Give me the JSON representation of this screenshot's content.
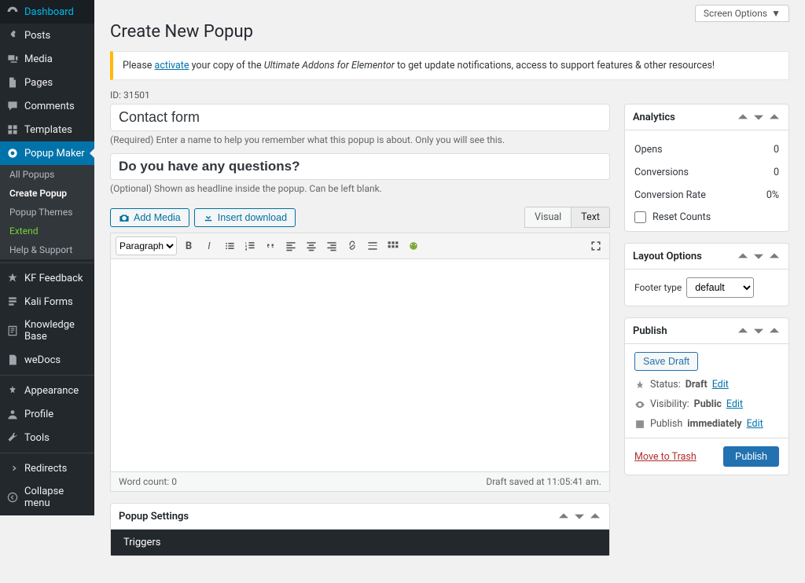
{
  "screen_options": "Screen Options",
  "page_title": "Create New Popup",
  "notice": {
    "prefix": "Please ",
    "activate_link": "activate",
    "middle": " your copy of the ",
    "product": "Ultimate Addons for Elementor",
    "suffix": " to get update notifications, access to support features & other resources!"
  },
  "post_id_label": "ID:",
  "post_id": "31501",
  "title_value": "Contact form",
  "title_hint": "(Required) Enter a name to help you remember what this popup is about. Only you will see this.",
  "headline_value": "Do you have any questions?",
  "headline_hint": "(Optional) Shown as headline inside the popup. Can be left blank.",
  "media": {
    "add_media": "Add Media",
    "insert_download": "Insert download"
  },
  "editor_tabs": {
    "visual": "Visual",
    "text": "Text"
  },
  "format_select": "Paragraph",
  "wordcount_label": "Word count:",
  "wordcount": "0",
  "draft_saved": "Draft saved at 11:05:41 am.",
  "panels": {
    "analytics": {
      "title": "Analytics",
      "opens_label": "Opens",
      "opens_value": "0",
      "conversions_label": "Conversions",
      "conversions_value": "0",
      "rate_label": "Conversion Rate",
      "rate_value": "0%",
      "reset_label": "Reset Counts"
    },
    "layout": {
      "title": "Layout Options",
      "footer_type_label": "Footer type",
      "footer_type_value": "default"
    },
    "publish": {
      "title": "Publish",
      "save_draft": "Save Draft",
      "status_label": "Status:",
      "status_value": "Draft",
      "visibility_label": "Visibility:",
      "visibility_value": "Public",
      "schedule_label": "Publish",
      "schedule_value": "immediately",
      "edit": "Edit",
      "trash": "Move to Trash",
      "publish_btn": "Publish"
    }
  },
  "popup_settings_title": "Popup Settings",
  "popup_settings_tab": "Triggers",
  "sidebar": {
    "items": [
      {
        "label": "Dashboard",
        "icon": "dashboard"
      },
      {
        "label": "Posts",
        "icon": "pin"
      },
      {
        "label": "Media",
        "icon": "media"
      },
      {
        "label": "Pages",
        "icon": "page"
      },
      {
        "label": "Comments",
        "icon": "comment"
      },
      {
        "label": "Templates",
        "icon": "templates"
      },
      {
        "label": "Popup Maker",
        "icon": "popup",
        "active": true
      },
      {
        "label": "KF Feedback",
        "icon": "star"
      },
      {
        "label": "Kali Forms",
        "icon": "forms"
      },
      {
        "label": "Knowledge Base",
        "icon": "kb"
      },
      {
        "label": "weDocs",
        "icon": "docs"
      },
      {
        "label": "Appearance",
        "icon": "appearance"
      },
      {
        "label": "Profile",
        "icon": "profile"
      },
      {
        "label": "Tools",
        "icon": "tools"
      },
      {
        "label": "Redirects",
        "icon": "redirect"
      },
      {
        "label": "Collapse menu",
        "icon": "collapse"
      }
    ],
    "submenu": [
      {
        "label": "All Popups"
      },
      {
        "label": "Create Popup",
        "current": true
      },
      {
        "label": "Popup Themes"
      },
      {
        "label": "Extend",
        "extend": true
      },
      {
        "label": "Help & Support"
      }
    ]
  }
}
